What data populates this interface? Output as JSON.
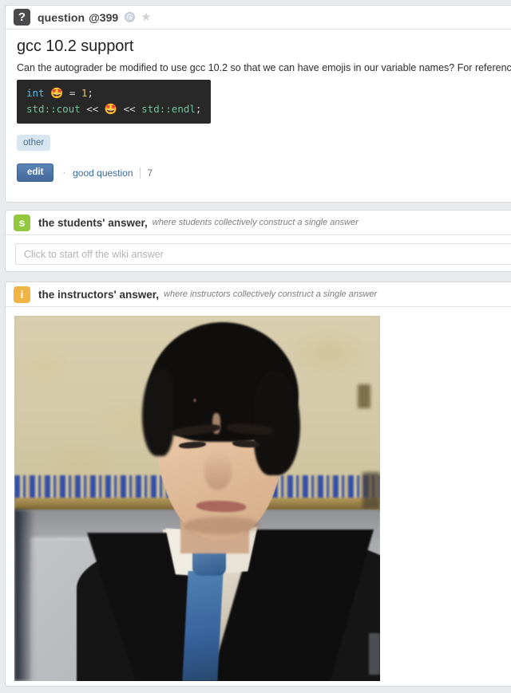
{
  "question": {
    "badge_letter": "?",
    "type_label": "question",
    "number": "@399",
    "icons": {
      "wiki": "wiki-circle-icon",
      "star": "★"
    },
    "title": "gcc 10.2 support",
    "body_text": "Can the autograder be modified to use gcc 10.2 so that we can have emojis in our variable names? For reference:",
    "code": {
      "line1": {
        "kw": "int",
        "emoji": "🤩",
        "op": "=",
        "num": "1",
        "semi": ";"
      },
      "line2": {
        "ns1": "std::cout",
        "op1": "<<",
        "emoji": "🤩",
        "op2": "<<",
        "ns2": "std::endl",
        "semi": ";"
      }
    },
    "tags": [
      "other"
    ],
    "actions": {
      "edit_label": "edit",
      "separator": "·",
      "good_question_label": "good question",
      "good_question_count": "7"
    }
  },
  "students_answer": {
    "badge_letter": "s",
    "title": "the students' answer,",
    "subtitle": "where students collectively construct a single answer",
    "wiki_placeholder": "Click to start off the wiki answer",
    "wiki_value": ""
  },
  "instructors_answer": {
    "badge_letter": "i",
    "title": "the instructors' answer,",
    "subtitle": "where instructors collectively construct a single answer",
    "attachment": "photo-skeptical-man-in-suit"
  },
  "colors": {
    "page_bg": "#e9eaed",
    "card_bg": "#ffffff",
    "question_badge": "#4a4a4d",
    "students_badge": "#93c83e",
    "instructors_badge": "#efb443",
    "edit_button": "#4e78ac",
    "link": "#3b6ba5",
    "tag_bg": "#d8e6f2",
    "tag_text": "#4a6b8a",
    "code_bg": "#282828"
  }
}
